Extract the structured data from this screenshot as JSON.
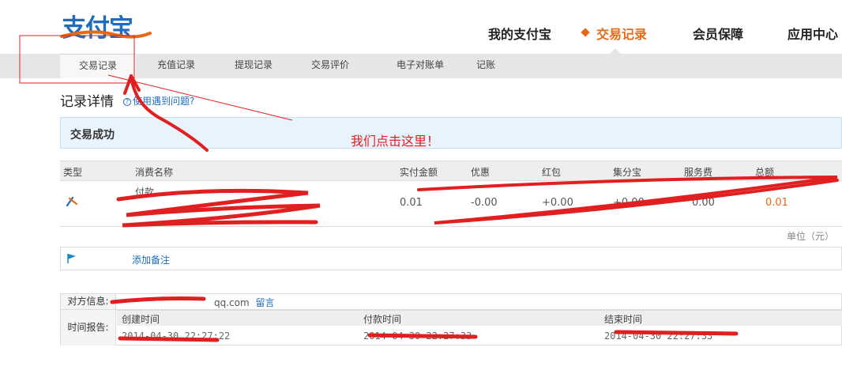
{
  "header": {
    "logo_text": "支付宝",
    "nav": [
      {
        "label": "我的支付宝",
        "active": false
      },
      {
        "label": "交易记录",
        "active": true
      },
      {
        "label": "会员保障",
        "active": false
      },
      {
        "label": "应用中心",
        "active": false
      }
    ],
    "accent_color": "#e66a14",
    "brand_color": "#1e6dc0"
  },
  "subnav": [
    {
      "label": "交易记录",
      "active": true
    },
    {
      "label": "充值记录",
      "active": false
    },
    {
      "label": "提现记录",
      "active": false
    },
    {
      "label": "交易评价",
      "active": false
    },
    {
      "label": "电子对账单",
      "active": false
    },
    {
      "label": "记账",
      "active": false
    }
  ],
  "detail": {
    "title": "记录详情",
    "help_link": "使用遇到问题?",
    "status": "交易成功"
  },
  "table": {
    "columns": [
      "类型",
      "消费名称",
      "实付金额",
      "优惠",
      "红包",
      "集分宝",
      "服务费",
      "总额"
    ],
    "row": {
      "type_icon": "transfer-icon",
      "name": "付款",
      "amount": "0.01",
      "discount": "-0.00",
      "red_packet": "+0.00",
      "jifenbao": "+0.00",
      "fee": "0.00",
      "total": "0.01"
    },
    "unit": "单位（元）"
  },
  "note": {
    "icon": "flag-icon",
    "link": "添加备注"
  },
  "counterpart": {
    "label": "对方信息:",
    "value": "qq.com",
    "message_link": "留言"
  },
  "time_report": {
    "label": "时间报告:",
    "columns": [
      "创建时间",
      "付款时间",
      "结束时间"
    ],
    "values": [
      "2014-04-30 22:27:22",
      "2014-04-30 22:27:33",
      "2014-04-30 22:27:33"
    ]
  },
  "annotation": {
    "text": "我们点击这里！",
    "color": "#e02020"
  }
}
